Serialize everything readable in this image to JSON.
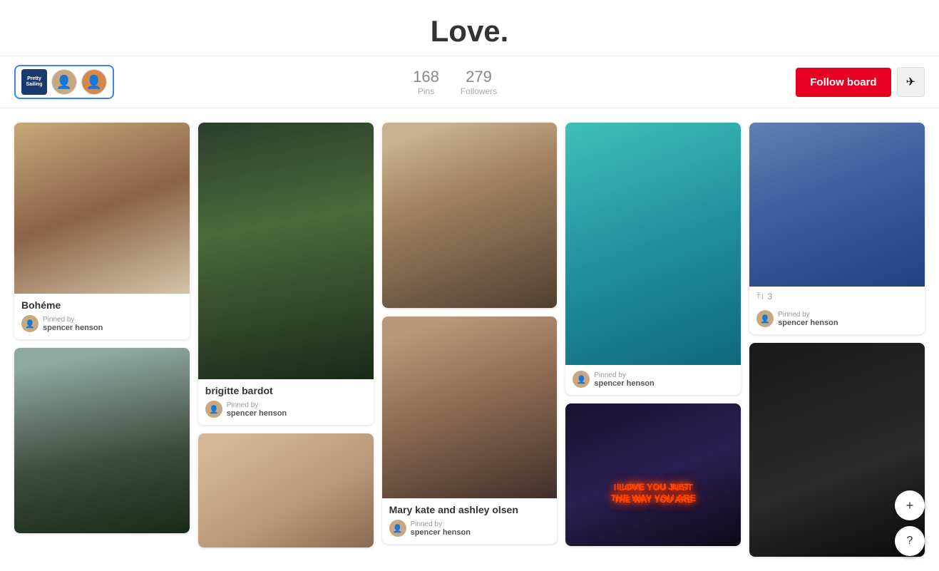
{
  "page": {
    "title": "Love."
  },
  "topbar": {
    "stats": {
      "pins": {
        "value": "168",
        "label": "Pins"
      },
      "followers": {
        "value": "279",
        "label": "Followers"
      }
    },
    "follow_button": "Follow board",
    "send_button": "✈"
  },
  "pins": [
    {
      "col": 0,
      "cards": [
        {
          "id": "boheme",
          "img_class": "img-boheme",
          "title": "Bohéme",
          "show_info": true,
          "pinned_by": "Pinned by",
          "author": "spencer henson",
          "likes": null
        },
        {
          "id": "lana",
          "img_class": "img-lana",
          "title": null,
          "show_info": false,
          "pinned_by": null,
          "author": null,
          "likes": null
        }
      ]
    },
    {
      "col": 1,
      "cards": [
        {
          "id": "brigitte",
          "img_class": "img-brigitte",
          "title": "brigitte bardot",
          "show_info": true,
          "pinned_by": "Pinned by",
          "author": "spencer henson",
          "likes": null
        },
        {
          "id": "bedroom",
          "img_class": "img-bedroom",
          "title": null,
          "show_info": false,
          "pinned_by": null,
          "author": null,
          "likes": null
        }
      ]
    },
    {
      "col": 2,
      "cards": [
        {
          "id": "blonde1",
          "img_class": "img-blonde1",
          "title": null,
          "show_info": false,
          "pinned_by": null,
          "author": null,
          "likes": null
        },
        {
          "id": "mary-kate",
          "img_class": "img-blonde2",
          "title": "Mary kate and ashley olsen",
          "show_info": true,
          "pinned_by": "Pinned by",
          "author": "spencer henson",
          "likes": null
        }
      ]
    },
    {
      "col": 3,
      "cards": [
        {
          "id": "underwater",
          "img_class": "img-underwater",
          "title": null,
          "show_info": true,
          "pinned_by": "Pinned by",
          "author": "spencer henson",
          "likes": null
        },
        {
          "id": "neon",
          "img_class": "img-neon neon-text-overlay",
          "title": null,
          "show_info": false,
          "pinned_by": null,
          "author": null,
          "likes": null
        }
      ]
    },
    {
      "col": 4,
      "cards": [
        {
          "id": "couple-mountain",
          "img_class": "img-couple-mountain",
          "title": null,
          "show_info": true,
          "pinned_by": "Pinned by",
          "author": "spencer henson",
          "likes": "3",
          "likes_show": true
        },
        {
          "id": "couple-dark",
          "img_class": "img-couple-dark",
          "title": null,
          "show_info": false,
          "pinned_by": null,
          "author": null,
          "likes": null
        }
      ]
    }
  ],
  "floating": {
    "plus": "+",
    "help": "?"
  }
}
